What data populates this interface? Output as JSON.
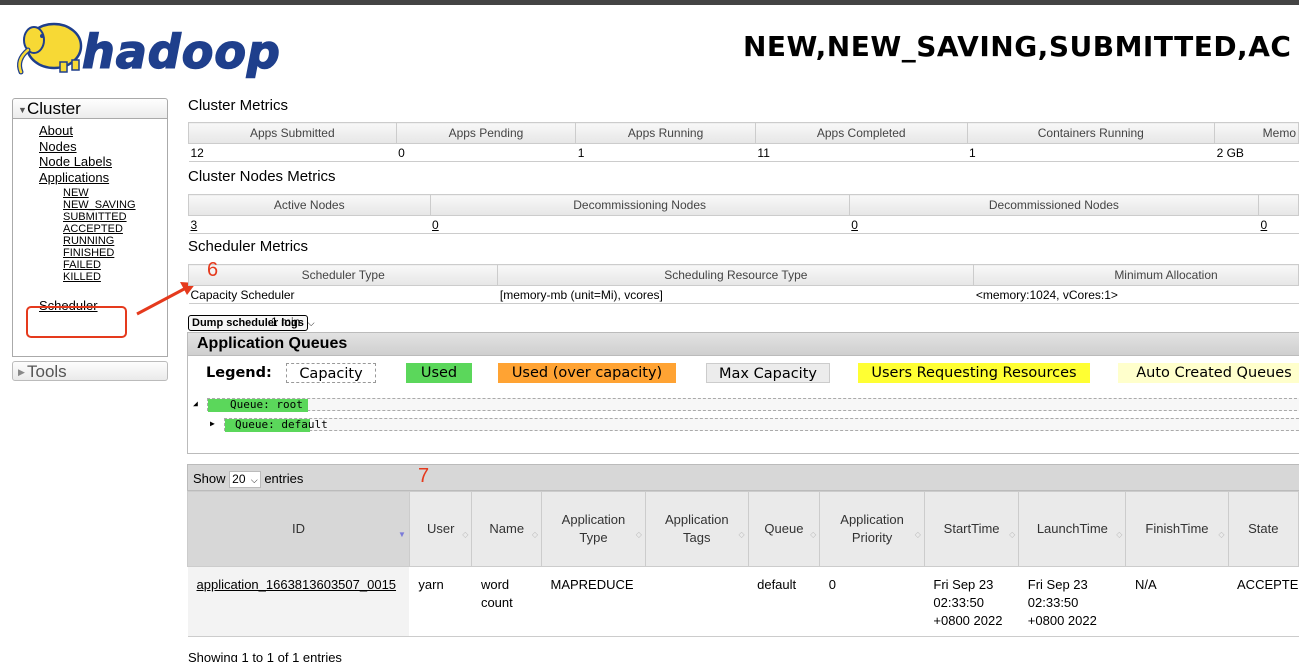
{
  "header": {
    "logo_text": "hadoop",
    "title": "NEW,NEW_SAVING,SUBMITTED,AC"
  },
  "sidebar": {
    "cluster_label": "Cluster",
    "links": [
      "About",
      "Nodes",
      "Node Labels",
      "Applications"
    ],
    "app_states": [
      "NEW",
      "NEW_SAVING",
      "SUBMITTED",
      "ACCEPTED",
      "RUNNING",
      "FINISHED",
      "FAILED",
      "KILLED"
    ],
    "scheduler": "Scheduler",
    "tools_label": "Tools"
  },
  "cluster_metrics": {
    "title": "Cluster Metrics",
    "headers": [
      "Apps Submitted",
      "Apps Pending",
      "Apps Running",
      "Apps Completed",
      "Containers Running",
      "Memo"
    ],
    "values": [
      "12",
      "0",
      "1",
      "11",
      "1",
      "2 GB"
    ]
  },
  "nodes_metrics": {
    "title": "Cluster Nodes Metrics",
    "headers": [
      "Active Nodes",
      "Decommissioning Nodes",
      "Decommissioned Nodes",
      ""
    ],
    "values": [
      "3",
      "0",
      "0",
      "0"
    ]
  },
  "scheduler_metrics": {
    "title": "Scheduler Metrics",
    "headers": [
      "Scheduler Type",
      "Scheduling Resource Type",
      "Minimum Allocation"
    ],
    "values": [
      "Capacity Scheduler",
      "[memory-mb (unit=Mi), vcores]",
      "<memory:1024, vCores:1>"
    ]
  },
  "annotations": {
    "six": "6",
    "seven": "7",
    "color": "#e53a1d"
  },
  "dump": {
    "button": "Dump scheduler logs",
    "interval": "1 min"
  },
  "queues": {
    "title": "Application Queues",
    "legend": {
      "title": "Legend:",
      "capacity": "Capacity",
      "used": "Used",
      "over": "Used (over capacity)",
      "max": "Max Capacity",
      "requesting": "Users Requesting Resources",
      "auto": "Auto Created Queues"
    },
    "root": "Queue: root",
    "default": "Queue: default"
  },
  "apps_table": {
    "show": "Show",
    "entries_count": "20",
    "entries": "entries",
    "headers": [
      "ID",
      "User",
      "Name",
      "Application Type",
      "Application Tags",
      "Queue",
      "Application Priority",
      "StartTime",
      "LaunchTime",
      "FinishTime",
      "State"
    ],
    "row": {
      "id": "application_1663813603507_0015",
      "user": "yarn",
      "name": "word count",
      "type": "MAPREDUCE",
      "tags": "",
      "queue": "default",
      "priority": "0",
      "start": "Fri Sep 23 02:33:50 +0800 2022",
      "launch": "Fri Sep 23 02:33:50 +0800 2022",
      "finish": "N/A",
      "state": "ACCEPTE"
    },
    "footer": "Showing 1 to 1 of 1 entries"
  }
}
